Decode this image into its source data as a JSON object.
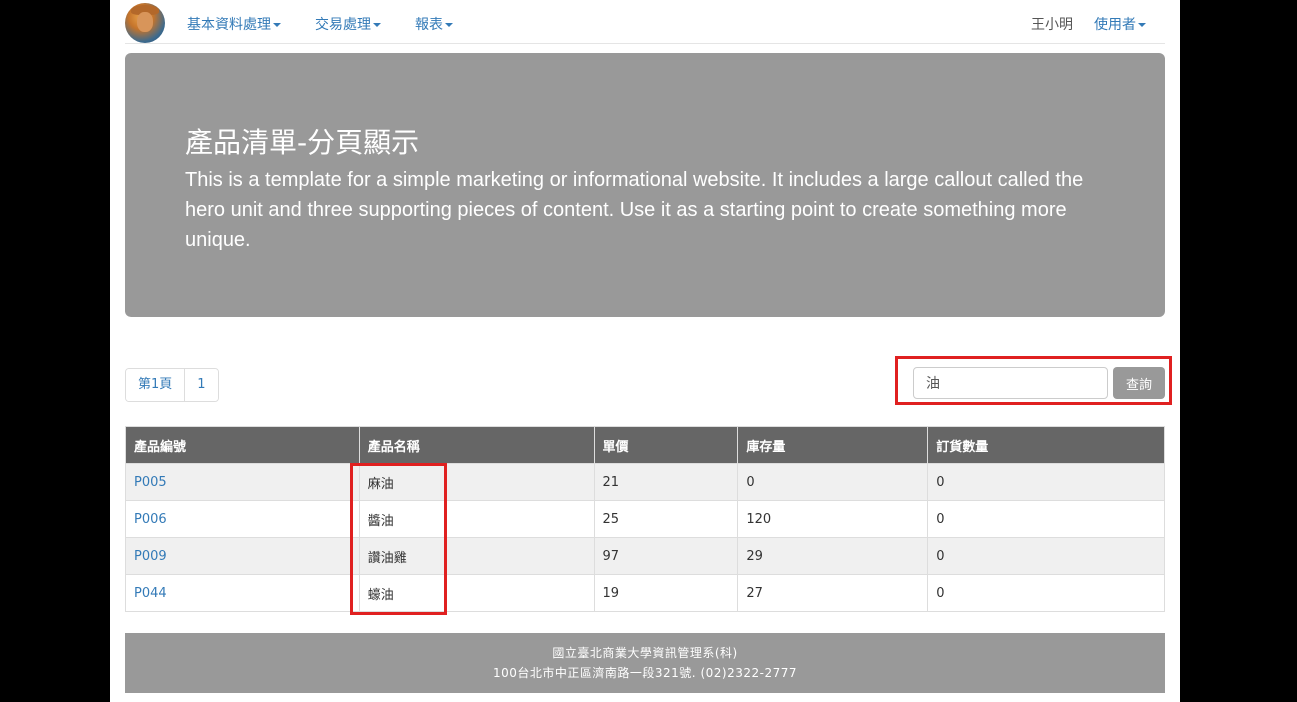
{
  "navbar": {
    "menu": [
      {
        "label": "基本資料處理"
      },
      {
        "label": "交易處理"
      },
      {
        "label": "報表"
      }
    ],
    "username": "王小明",
    "user_menu_label": "使用者"
  },
  "hero": {
    "title": "產品清單-分頁顯示",
    "text": "This is a template for a simple marketing or informational website. It includes a large callout called the hero unit and three supporting pieces of content. Use it as a starting point to create something more unique."
  },
  "pagination": {
    "items": [
      "第1頁",
      "1"
    ]
  },
  "search": {
    "value": "油",
    "button_label": "查詢"
  },
  "table": {
    "headers": [
      "產品編號",
      "產品名稱",
      "單價",
      "庫存量",
      "訂貨數量"
    ],
    "rows": [
      {
        "id": "P005",
        "name": "麻油",
        "price": "21",
        "stock": "0",
        "order_qty": "0"
      },
      {
        "id": "P006",
        "name": "醬油",
        "price": "25",
        "stock": "120",
        "order_qty": "0"
      },
      {
        "id": "P009",
        "name": "讚油雞",
        "price": "97",
        "stock": "29",
        "order_qty": "0"
      },
      {
        "id": "P044",
        "name": "蠔油",
        "price": "19",
        "stock": "27",
        "order_qty": "0"
      }
    ]
  },
  "footer": {
    "line1": "國立臺北商業大學資訊管理系(科)",
    "line2": "100台北市中正區濟南路一段321號. (02)2322-2777"
  },
  "colors": {
    "link": "#337ab7",
    "hero_bg": "#999999",
    "table_header_bg": "#666666",
    "highlight": "#e02020"
  }
}
